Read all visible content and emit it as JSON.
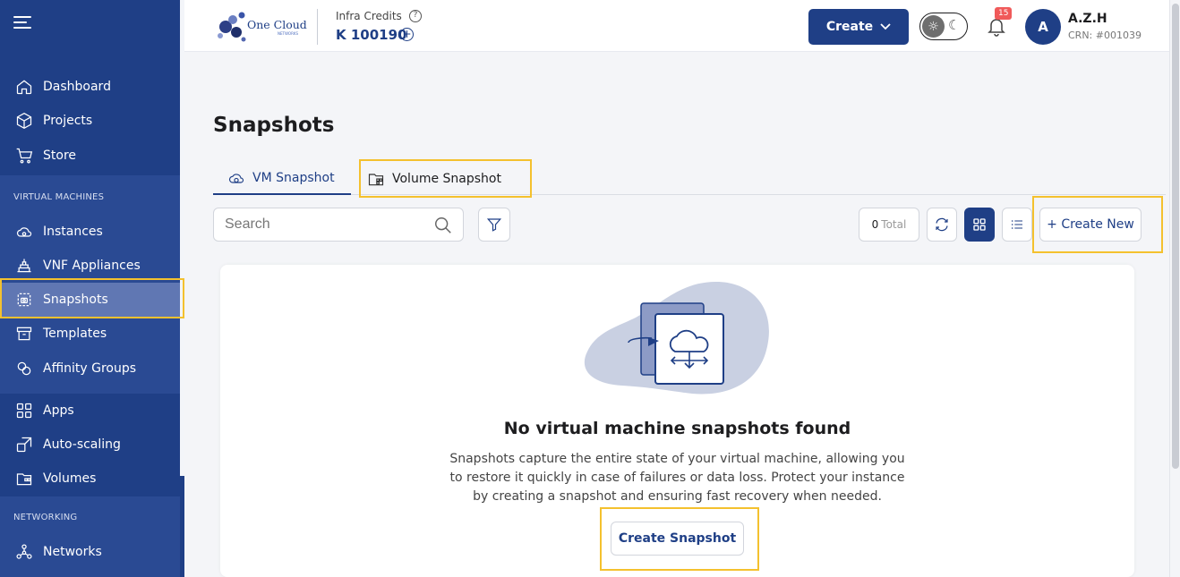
{
  "brand": {
    "name": "One Cloud",
    "tagline": "NETWORKS"
  },
  "header": {
    "credits_label": "Infra Credits",
    "credits_value": "K 100190",
    "create_label": "Create",
    "notification_count": "15",
    "avatar_initial": "A",
    "user_name": "A.Z.H",
    "user_crn": "CRN: #001039"
  },
  "sidebar": {
    "items_top": [
      {
        "label": "Dashboard",
        "icon": "home-icon"
      },
      {
        "label": "Projects",
        "icon": "cube-icon"
      },
      {
        "label": "Store",
        "icon": "cart-icon"
      }
    ],
    "section_vm": "VIRTUAL MACHINES",
    "items_vm": [
      {
        "label": "Instances",
        "icon": "cloud-icon"
      },
      {
        "label": "VNF Appliances",
        "icon": "firewall-icon"
      },
      {
        "label": "Snapshots",
        "icon": "camera-icon"
      },
      {
        "label": "Templates",
        "icon": "archive-icon"
      },
      {
        "label": "Affinity Groups",
        "icon": "group-icon"
      }
    ],
    "items_mid": [
      {
        "label": "Apps",
        "icon": "apps-icon"
      },
      {
        "label": "Auto-scaling",
        "icon": "autoscale-icon"
      },
      {
        "label": "Volumes",
        "icon": "volume-icon"
      }
    ],
    "section_net": "NETWORKING",
    "items_net": [
      {
        "label": "Networks",
        "icon": "network-icon"
      }
    ]
  },
  "page": {
    "title": "Snapshots",
    "tabs": [
      {
        "label": "VM Snapshot",
        "icon": "cloud-sync-icon",
        "active": true
      },
      {
        "label": "Volume Snapshot",
        "icon": "volume-icon",
        "active": false
      }
    ],
    "search_placeholder": "Search",
    "total_count": "0",
    "total_label": "Total",
    "create_new_label": "+ Create New"
  },
  "empty_state": {
    "title": "No virtual machine snapshots found",
    "description": "Snapshots capture the entire state of your virtual machine, allowing you to restore it quickly in case of failures or data loss. Protect your instance by creating a snapshot and ensuring fast recovery when needed.",
    "button_label": "Create Snapshot"
  },
  "colors": {
    "primary": "#1f3f86",
    "highlight": "#f4c12e",
    "badge": "#f05a5a"
  }
}
